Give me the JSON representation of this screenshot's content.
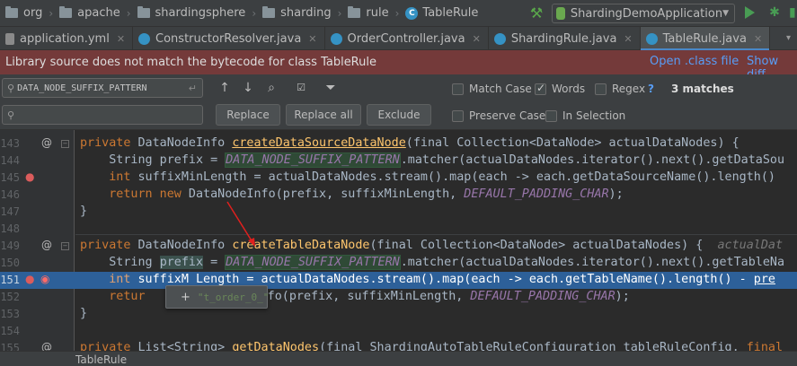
{
  "breadcrumb": [
    "org",
    "apache",
    "shardingsphere",
    "sharding",
    "rule",
    "TableRule"
  ],
  "run_config": {
    "name": "ShardingDemoApplication"
  },
  "tabs": [
    {
      "label": "application.yml",
      "icon": "yml-file-icon",
      "active": false
    },
    {
      "label": "ConstructorResolver.java",
      "icon": "class-icon",
      "active": false
    },
    {
      "label": "OrderController.java",
      "icon": "class-icon",
      "active": false
    },
    {
      "label": "ShardingRule.java",
      "icon": "class-icon",
      "active": false
    },
    {
      "label": "TableRule.java",
      "icon": "class-icon",
      "active": true
    }
  ],
  "banner": {
    "message": "Library source does not match the bytecode for class TableRule",
    "open_class_file": "Open .class file",
    "show_diff": "Show diff"
  },
  "find": {
    "search_text": "DATA_NODE_SUFFIX_PATTERN",
    "match_case": "Match Case",
    "words": "Words",
    "regex": "Regex",
    "help": "?",
    "matches": "3 matches",
    "replace_text": "",
    "replace": "Replace",
    "replace_all": "Replace all",
    "exclude": "Exclude",
    "preserve_case": "Preserve Case",
    "in_selection": "In Selection",
    "options": {
      "match_case": false,
      "words": true,
      "regex": false,
      "preserve_case": false,
      "in_selection": false
    }
  },
  "editor": {
    "line_numbers": [
      "143",
      "144",
      "145",
      "146",
      "147",
      "148",
      "149",
      "150",
      "151",
      "152",
      "153",
      "154",
      "155"
    ],
    "execution_line": "151",
    "tokens": {
      "private": "private",
      "ret_type_1": " DataNodeInfo ",
      "method_1": "createDataSourceDataNode",
      "param_sig": "(final Collection<DataNode> actualDataNodes) {",
      "string_decl": "String prefix = ",
      "pattern": "DATA_NODE_SUFFIX_PATTERN",
      "matcher_1": ".matcher(actualDataNodes.iterator().next().getDataSou",
      "int": "int",
      "suffix_decl": " suffixMinLength = actualDataNodes.stream().map(each -> each.getDataSourceName().length()",
      "return_new": "return new",
      "ret_call_1": " DataNodeInfo(prefix, suffixMinLength, ",
      "padding": "DEFAULT_PADDING_CHAR",
      "ret_end": ");",
      "close": "}",
      "method_2": "createTableDataNode",
      "param_sig_2": "(final Collection<DataNode> actualDataNodes) {  ",
      "hint": "actualDat",
      "string_decl_2a": "String ",
      "prefix_var": "prefix",
      "string_decl_2b": " = ",
      "matcher_2": ".matcher(actualDataNodes.iterator().next().getTableNa",
      "int_2a": " suffixM",
      "int_2b": "Length = actualDataNodes.stream().map(each -> each.getTableName().length() - ",
      "pre": "pre",
      "return_2a": "retur",
      "return_2b": "Info(prefix, suffixMinLength, ",
      "private_3": "private",
      "line155_a": " List<String> ",
      "method_3": "getDataNodes",
      "line155_b": "(final ShardingAutoTableRuleConfiguration tableRuleConfig, ",
      "final": "final"
    }
  },
  "tooltip": {
    "plus": "+",
    "value": "\"t_order_0_\""
  },
  "status": {
    "label": "TableRule"
  },
  "colors": {
    "banner": "#743a3a",
    "execution_line": "#2d6099",
    "tab_active_underline": "#4a88c7",
    "search_hit": "#2f4a36"
  }
}
